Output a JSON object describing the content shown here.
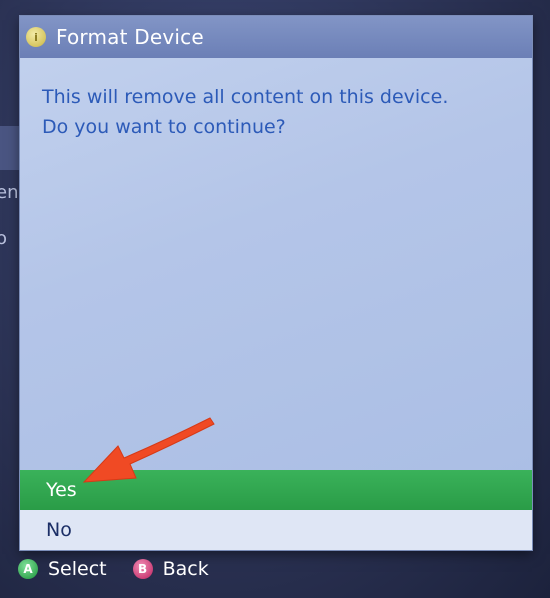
{
  "dialog": {
    "title": "Format Device",
    "message_line1": "This will remove all content on this device.",
    "message_line2": "Do you want to continue?",
    "options": [
      {
        "label": "Yes",
        "selected": true
      },
      {
        "label": "No",
        "selected": false
      }
    ]
  },
  "footer": {
    "select_label": "Select",
    "select_button": "A",
    "back_label": "Back",
    "back_button": "B"
  },
  "background": {
    "fragment1": "en",
    "fragment2": "o"
  },
  "colors": {
    "selected_option": "#2fa84f",
    "title_bar": "#7589c0",
    "message_text": "#2c5ab8",
    "annotation_arrow": "#f04a24"
  },
  "icons": {
    "title_icon": "info-icon",
    "select_icon": "a-button-icon",
    "back_icon": "b-button-icon",
    "annotation": "red-arrow-icon"
  }
}
